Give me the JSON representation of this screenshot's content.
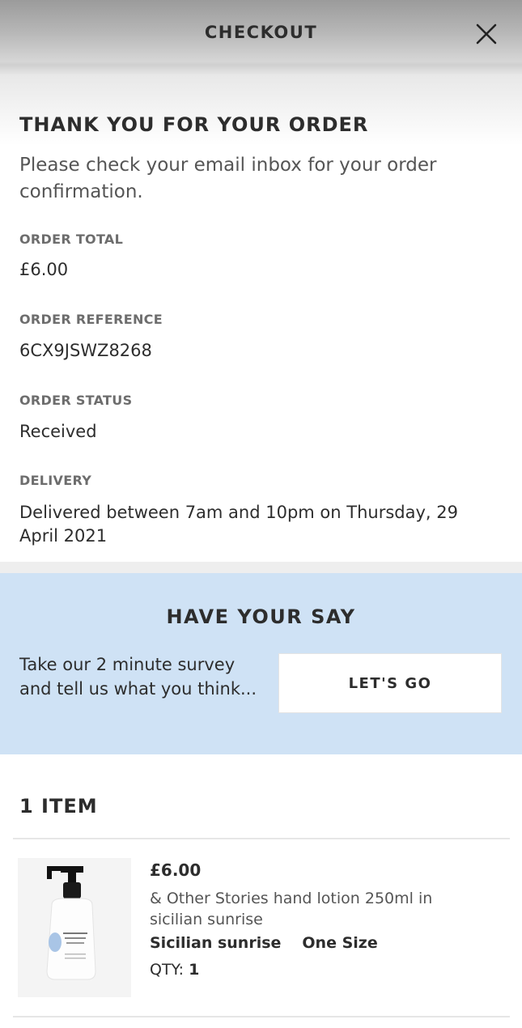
{
  "header": {
    "title": "CHECKOUT",
    "close_icon": "close-icon"
  },
  "confirmation": {
    "title": "THANK YOU FOR YOUR ORDER",
    "subtitle": "Please check your email inbox for your order confirmation."
  },
  "order": {
    "total_label": "ORDER TOTAL",
    "total_value": "£6.00",
    "reference_label": "ORDER REFERENCE",
    "reference_value": "6CX9JSWZ8268",
    "status_label": "ORDER STATUS",
    "status_value": "Received",
    "delivery_label": "DELIVERY",
    "delivery_value": "Delivered between 7am and 10pm on Thursday, 29 April 2021"
  },
  "survey": {
    "title": "HAVE YOUR SAY",
    "text": "Take our 2 minute survey and tell us what you think...",
    "button_label": "LET'S GO",
    "background": "#cfe2f5"
  },
  "items": {
    "count_label": "1 ITEM",
    "list": [
      {
        "price": "£6.00",
        "name": "& Other Stories hand lotion 250ml in sicilian sunrise",
        "colour": "Sicilian sunrise",
        "size": "One Size",
        "qty_label": "QTY:",
        "qty_value": "1",
        "image_icon": "hand-lotion-bottle-image"
      }
    ]
  }
}
